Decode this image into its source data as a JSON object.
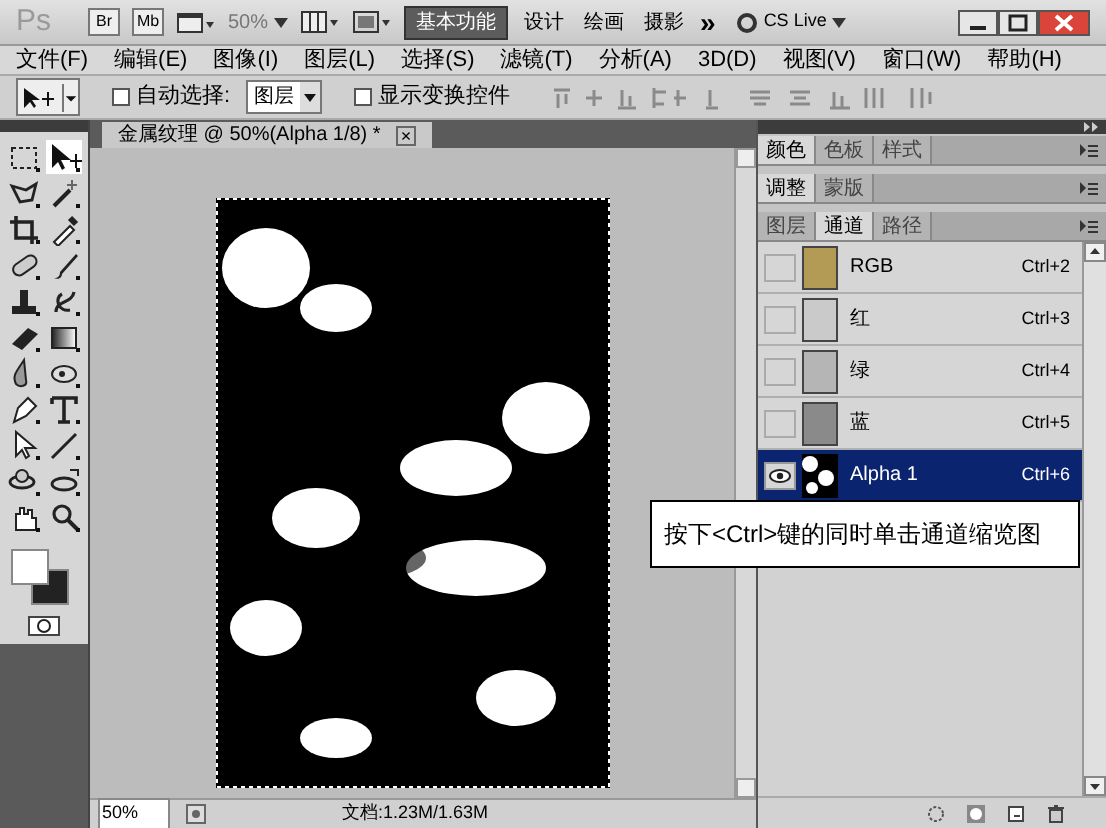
{
  "app_bar": {
    "logo": "Ps",
    "bridge": "Br",
    "mini_bridge": "Mb",
    "zoom": "50%",
    "workspaces": [
      {
        "label": "基本功能",
        "selected": true
      },
      {
        "label": "设计",
        "selected": false
      },
      {
        "label": "绘画",
        "selected": false
      },
      {
        "label": "摄影",
        "selected": false
      }
    ],
    "overflow": "»",
    "cs_live": "CS Live"
  },
  "menu": [
    "文件(F)",
    "编辑(E)",
    "图像(I)",
    "图层(L)",
    "选择(S)",
    "滤镜(T)",
    "分析(A)",
    "3D(D)",
    "视图(V)",
    "窗口(W)",
    "帮助(H)"
  ],
  "options_bar": {
    "auto_select": {
      "label": "自动选择:",
      "checked": false
    },
    "target": "图层",
    "show_transform": {
      "label": "显示变换控件",
      "checked": false
    }
  },
  "tools": [
    {
      "kind": "marquee",
      "selected": false
    },
    {
      "kind": "move",
      "selected": true
    },
    {
      "kind": "lasso",
      "selected": false
    },
    {
      "kind": "wand",
      "selected": false
    },
    {
      "kind": "crop",
      "selected": false
    },
    {
      "kind": "eyedropper",
      "selected": false
    },
    {
      "kind": "bandage",
      "selected": false
    },
    {
      "kind": "brush",
      "selected": false
    },
    {
      "kind": "stamp",
      "selected": false
    },
    {
      "kind": "history",
      "selected": false
    },
    {
      "kind": "eraser",
      "selected": false
    },
    {
      "kind": "gradient",
      "selected": false
    },
    {
      "kind": "drop",
      "selected": false
    },
    {
      "kind": "dodge",
      "selected": false
    },
    {
      "kind": "pen",
      "selected": false
    },
    {
      "kind": "type",
      "selected": false
    },
    {
      "kind": "arrow",
      "selected": false
    },
    {
      "kind": "line",
      "selected": false
    },
    {
      "kind": "rotate3d",
      "selected": false
    },
    {
      "kind": "orbit3d",
      "selected": false
    },
    {
      "kind": "hand",
      "selected": false
    },
    {
      "kind": "zoom",
      "selected": false
    }
  ],
  "document": {
    "tab": "金属纹理 @ 50%(Alpha 1/8) *",
    "close": "×",
    "status_zoom": "50%",
    "status_info": "文档:1.23M/1.63M"
  },
  "panel_groups": [
    {
      "tabs": [
        {
          "label": "颜色",
          "selected": true
        },
        {
          "label": "色板",
          "selected": false
        },
        {
          "label": "样式",
          "selected": false
        }
      ]
    },
    {
      "tabs": [
        {
          "label": "调整",
          "selected": true
        },
        {
          "label": "蒙版",
          "selected": false
        }
      ]
    },
    {
      "tabs": [
        {
          "label": "图层",
          "selected": false
        },
        {
          "label": "通道",
          "selected": true
        },
        {
          "label": "路径",
          "selected": false
        }
      ]
    }
  ],
  "channels": [
    {
      "name": "RGB",
      "shortcut": "Ctrl+2",
      "kind": "color",
      "color": "#b39a55",
      "visible": false,
      "selected": false
    },
    {
      "name": "红",
      "shortcut": "Ctrl+3",
      "kind": "color",
      "color": "#cacaca",
      "visible": false,
      "selected": false
    },
    {
      "name": "绿",
      "shortcut": "Ctrl+4",
      "kind": "color",
      "color": "#b5b5b5",
      "visible": false,
      "selected": false
    },
    {
      "name": "蓝",
      "shortcut": "Ctrl+5",
      "kind": "color",
      "color": "#8a8a8a",
      "visible": false,
      "selected": false
    },
    {
      "name": "Alpha 1",
      "shortcut": "Ctrl+6",
      "kind": "mask",
      "visible": true,
      "selected": true
    }
  ],
  "callout": "按下<Ctrl>键的同时单击通道缩览图"
}
